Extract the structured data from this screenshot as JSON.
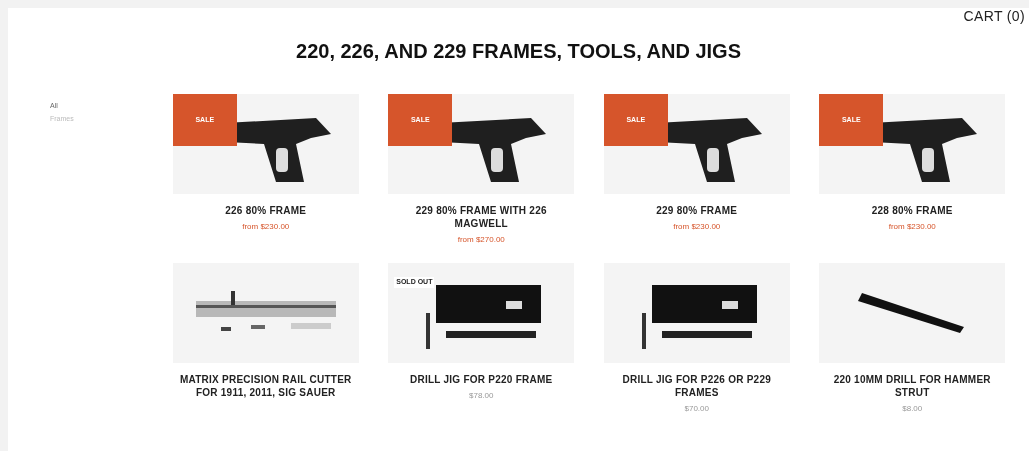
{
  "header": {
    "cart": "CART (0)"
  },
  "title": "220, 226, AND 229 FRAMES, TOOLS, AND JIGS",
  "sidebar": {
    "items": [
      {
        "label": "All",
        "selected": true
      },
      {
        "label": "Frames",
        "selected": false
      }
    ]
  },
  "products": [
    {
      "name": "226 80% FRAME",
      "price": "from $230.00",
      "badge": "SALE",
      "kind": "frame"
    },
    {
      "name": "229 80% FRAME WITH 226 MAGWELL",
      "price": "from $270.00",
      "badge": "SALE",
      "kind": "frame"
    },
    {
      "name": "229 80% FRAME",
      "price": "from $230.00",
      "badge": "SALE",
      "kind": "frame"
    },
    {
      "name": "228 80% FRAME",
      "price": "from $230.00",
      "badge": "SALE",
      "kind": "frame"
    },
    {
      "name": "MATRIX PRECISION RAIL CUTTER FOR 1911, 2011, SIG SAUER",
      "kind": "cutter"
    },
    {
      "name": "DRILL JIG FOR P220 FRAME",
      "price": "$78.00",
      "sold_out": "SOLD OUT",
      "kind": "jig"
    },
    {
      "name": "DRILL JIG FOR P226 OR P229 FRAMES",
      "price": "$70.00",
      "kind": "jig"
    },
    {
      "name": "220 10MM DRILL FOR HAMMER STRUT",
      "price": "$8.00",
      "kind": "drill"
    }
  ]
}
